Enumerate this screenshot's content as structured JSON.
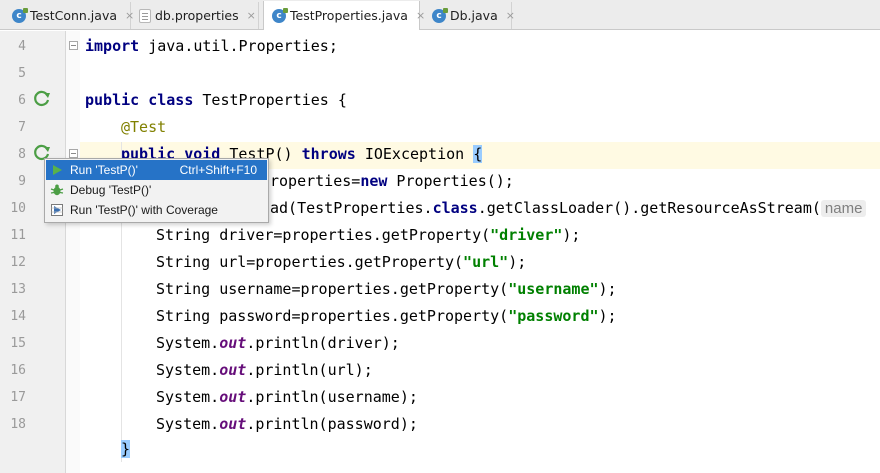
{
  "tabs": [
    {
      "label": "TestConn.java",
      "icon": "java-class-icon",
      "active": false
    },
    {
      "label": "db.properties",
      "icon": "properties-file-icon",
      "active": false
    },
    {
      "label": "TestProperties.java",
      "icon": "java-class-icon",
      "active": true
    },
    {
      "label": "Db.java",
      "icon": "java-class-icon",
      "active": false
    }
  ],
  "tab_close_glyph": "×",
  "line_numbers": [
    "4",
    "5",
    "6",
    "7",
    "8",
    "9",
    "10",
    "11",
    "12",
    "13",
    "14",
    "15",
    "16",
    "17",
    "18"
  ],
  "code": {
    "l4_kw": "import",
    "l4_rest": " java.util.Properties;",
    "l6_kw1": "public",
    "l6_kw2": "class",
    "l6_rest": " TestProperties {",
    "l7_ann": "@Test",
    "l8_kw1": "public",
    "l8_kw2": "void",
    "l8_mid": " TestP() ",
    "l8_kw3": "throws",
    "l8_rest": " IOException ",
    "l8_brace": "{",
    "l9_pre": "roperties=",
    "l9_kw": "new",
    "l9_rest": " Properties();",
    "l10_pre": "ad(TestProperties.",
    "l10_kw": "class",
    "l10_rest": ".getClassLoader().getResourceAsStream(",
    "l10_hint": "name",
    "l11_pre": "String driver=properties.getProperty(",
    "l11_str": "\"driver\"",
    "l11_post": ");",
    "l12_pre": "String url=properties.getProperty(",
    "l12_str": "\"url\"",
    "l12_post": ");",
    "l13_pre": "String username=properties.getProperty(",
    "l13_str": "\"username\"",
    "l13_post": ");",
    "l14_pre": "String password=properties.getProperty(",
    "l14_str": "\"password\"",
    "l14_post": ");",
    "sys": "System.",
    "out": "out",
    "l15_post": ".println(driver);",
    "l16_post": ".println(url);",
    "l17_post": ".println(username);",
    "l18_post": ".println(password);",
    "l19_brace": "}"
  },
  "popup": {
    "items": [
      {
        "label": "Run 'TestP()'",
        "shortcut": "Ctrl+Shift+F10",
        "icon": "run-icon",
        "selected": true
      },
      {
        "label": "Debug 'TestP()'",
        "shortcut": "",
        "icon": "debug-icon",
        "selected": false
      },
      {
        "label": "Run 'TestP()' with Coverage",
        "shortcut": "",
        "icon": "coverage-icon",
        "selected": false
      }
    ]
  },
  "colors": {
    "keyword": "#000080",
    "string": "#008000",
    "annotation": "#808000",
    "static_field": "#660e7a",
    "selection": "#2673c7",
    "caret_line": "#fffae3"
  }
}
